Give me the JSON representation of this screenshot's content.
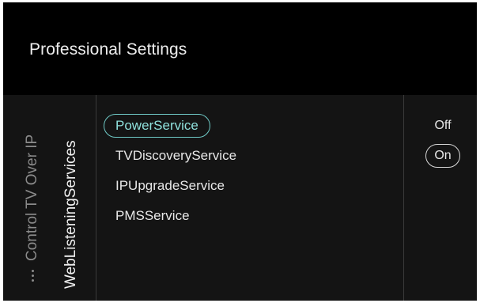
{
  "header": {
    "title": "Professional Settings"
  },
  "breadcrumb": {
    "ellipsis_icon": "vertical-ellipsis-icon",
    "parent": "Control TV Over IP",
    "current": "WebListeningServices"
  },
  "menu": {
    "items": [
      {
        "label": "PowerService",
        "selected": true
      },
      {
        "label": "TVDiscoveryService",
        "selected": false
      },
      {
        "label": "IPUpgradeService",
        "selected": false
      },
      {
        "label": "PMSService",
        "selected": false
      }
    ]
  },
  "options": {
    "items": [
      {
        "label": "Off",
        "checked": false
      },
      {
        "label": "On",
        "checked": true
      }
    ]
  },
  "colors": {
    "background": "#000000",
    "panel": "#141414",
    "accent": "#6fc9c6",
    "text": "#e8e8e8",
    "muted_text": "#8a8a8a"
  }
}
